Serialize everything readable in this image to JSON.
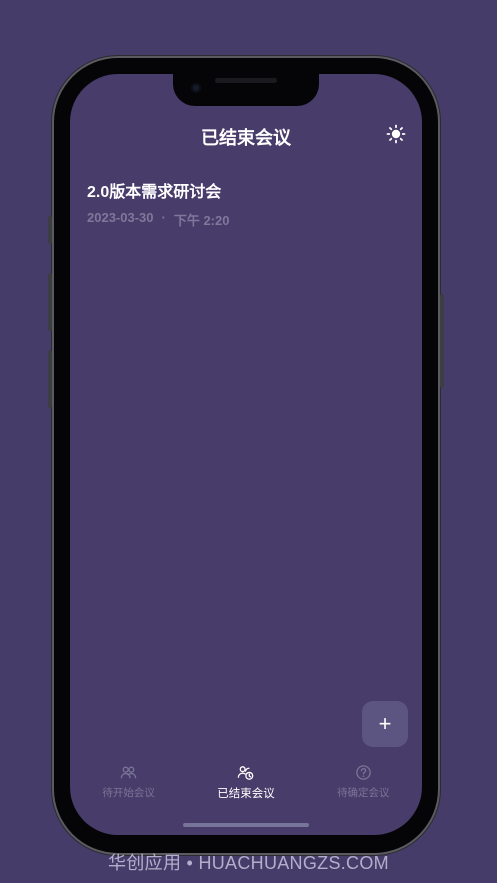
{
  "header": {
    "title": "已结束会议",
    "theme_icon": "sun-icon"
  },
  "meetings": [
    {
      "title": "2.0版本需求研讨会",
      "date": "2023-03-30",
      "separator": "·",
      "time": "下午 2:20"
    }
  ],
  "fab": {
    "label": "+",
    "icon": "plus-icon"
  },
  "tabs": [
    {
      "label": "待开始会议",
      "icon": "people-icon",
      "active": false
    },
    {
      "label": "已结束会议",
      "icon": "finished-meeting-icon",
      "active": true
    },
    {
      "label": "待确定会议",
      "icon": "question-icon",
      "active": false
    }
  ],
  "watermark": "华创应用 • HUACHUANGZS.COM",
  "colors": {
    "background": "#463c69",
    "screen": "#473c6a",
    "accent": "#ffffff",
    "muted": "#7a7496"
  }
}
